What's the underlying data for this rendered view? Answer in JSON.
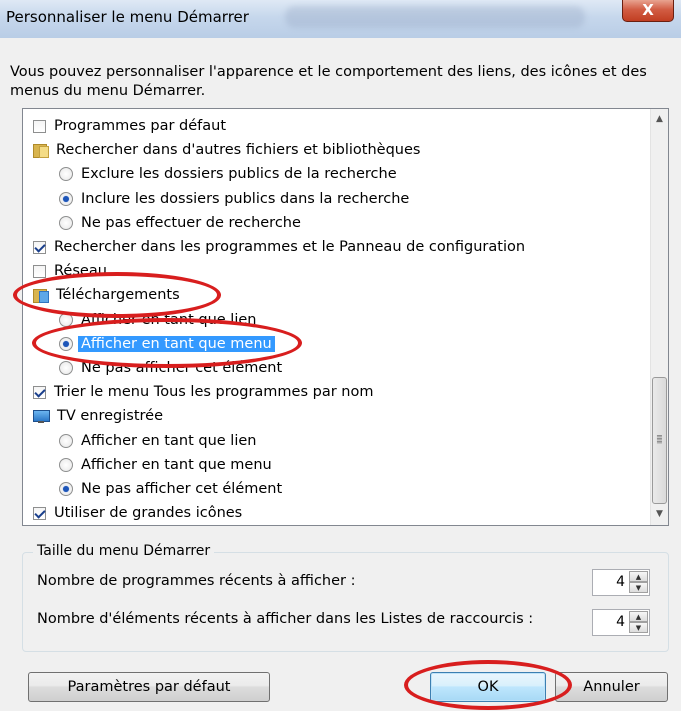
{
  "window": {
    "title": "Personnaliser le menu Démarrer",
    "close_label": "X"
  },
  "intro_text": "Vous pouvez personnaliser l'apparence et le comportement des liens, des icônes et des menus du menu Démarrer.",
  "options": [
    {
      "type": "checkbox",
      "level": 0,
      "checked": false,
      "label": "Programmes par défaut"
    },
    {
      "type": "folder",
      "level": 0,
      "icon": "folder-icon",
      "label": "Rechercher dans d'autres fichiers et bibliothèques"
    },
    {
      "type": "radio",
      "level": 1,
      "checked": false,
      "label": "Exclure les dossiers publics de la recherche"
    },
    {
      "type": "radio",
      "level": 1,
      "checked": true,
      "label": "Inclure les dossiers publics dans la recherche"
    },
    {
      "type": "radio",
      "level": 1,
      "checked": false,
      "label": "Ne pas effectuer de recherche"
    },
    {
      "type": "checkbox",
      "level": 0,
      "checked": true,
      "label": "Rechercher dans les programmes et le Panneau de configuration"
    },
    {
      "type": "checkbox",
      "level": 0,
      "checked": false,
      "label": "Réseau"
    },
    {
      "type": "folder",
      "level": 0,
      "icon": "downloads-folder-icon",
      "label": "Téléchargements"
    },
    {
      "type": "radio",
      "level": 1,
      "checked": false,
      "label": "Afficher en tant que lien"
    },
    {
      "type": "radio",
      "level": 1,
      "checked": true,
      "selected": true,
      "label": "Afficher en tant que menu"
    },
    {
      "type": "radio",
      "level": 1,
      "checked": false,
      "label": "Ne pas afficher cet élément"
    },
    {
      "type": "checkbox",
      "level": 0,
      "checked": true,
      "label": "Trier le menu Tous les programmes par nom"
    },
    {
      "type": "folder",
      "level": 0,
      "icon": "tv-icon",
      "label": "TV enregistrée"
    },
    {
      "type": "radio",
      "level": 1,
      "checked": false,
      "label": "Afficher en tant que lien"
    },
    {
      "type": "radio",
      "level": 1,
      "checked": false,
      "label": "Afficher en tant que menu"
    },
    {
      "type": "radio",
      "level": 1,
      "checked": true,
      "label": "Ne pas afficher cet élément"
    },
    {
      "type": "checkbox",
      "level": 0,
      "checked": true,
      "label": "Utiliser de grandes icônes"
    }
  ],
  "size_group": {
    "title": "Taille du menu Démarrer",
    "recent_programs_label": "Nombre de programmes récents à afficher :",
    "recent_programs_value": "4",
    "recent_items_label": "Nombre d'éléments récents à afficher dans les Listes de raccourcis :",
    "recent_items_value": "4"
  },
  "buttons": {
    "defaults": "Paramètres par défaut",
    "ok": "OK",
    "cancel": "Annuler"
  },
  "colors": {
    "selection": "#3399ff",
    "annotation": "#d81e1e"
  }
}
